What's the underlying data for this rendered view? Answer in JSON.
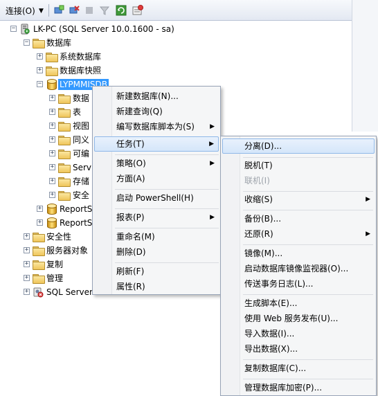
{
  "toolbar": {
    "connect_label": "连接(O)",
    "icons": [
      "connect-icon",
      "disconnect-icon",
      "stop-icon",
      "filter-icon",
      "refresh-icon",
      "activity-icon"
    ]
  },
  "tree": {
    "server": "LK-PC (SQL Server 10.0.1600 - sa)",
    "databases": "数据库",
    "system_databases": "系统数据库",
    "db_snapshots": "数据库快照",
    "selected_db": "LYPMMISDB",
    "db_children": [
      "数据",
      "表",
      "视图",
      "同义",
      "可编",
      "Serv",
      "存储",
      "安全"
    ],
    "report_server": "ReportS",
    "report_server_temp": "ReportS",
    "security": "安全性",
    "server_objects": "服务器对象",
    "replication": "复制",
    "management": "管理",
    "sql_agent": "SQL Server"
  },
  "context_menu": {
    "items": [
      {
        "label": "新建数据库(N)..."
      },
      {
        "label": "新建查询(Q)"
      },
      {
        "label": "编写数据库脚本为(S)"
      },
      {
        "label": "任务(T)"
      },
      {
        "label": "策略(O)"
      },
      {
        "label": "方面(A)"
      },
      {
        "label": "启动 PowerShell(H)"
      },
      {
        "label": "报表(P)"
      },
      {
        "label": "重命名(M)"
      },
      {
        "label": "删除(D)"
      },
      {
        "label": "刷新(F)"
      },
      {
        "label": "属性(R)"
      }
    ]
  },
  "tasks_menu": {
    "items": [
      {
        "label": "分离(D)..."
      },
      {
        "label": "脱机(T)"
      },
      {
        "label": "联机(I)"
      },
      {
        "label": "收缩(S)"
      },
      {
        "label": "备份(B)..."
      },
      {
        "label": "还原(R)"
      },
      {
        "label": "镜像(M)..."
      },
      {
        "label": "启动数据库镜像监视器(O)..."
      },
      {
        "label": "传送事务日志(L)..."
      },
      {
        "label": "生成脚本(E)..."
      },
      {
        "label": "使用 Web 服务发布(U)..."
      },
      {
        "label": "导入数据(I)..."
      },
      {
        "label": "导出数据(X)..."
      },
      {
        "label": "复制数据库(C)..."
      },
      {
        "label": "管理数据库加密(P)..."
      }
    ]
  },
  "colors": {
    "selection": "#3399ff",
    "menu_highlight": "#d5e6fa",
    "menu_bg": "#f5f6f7"
  }
}
